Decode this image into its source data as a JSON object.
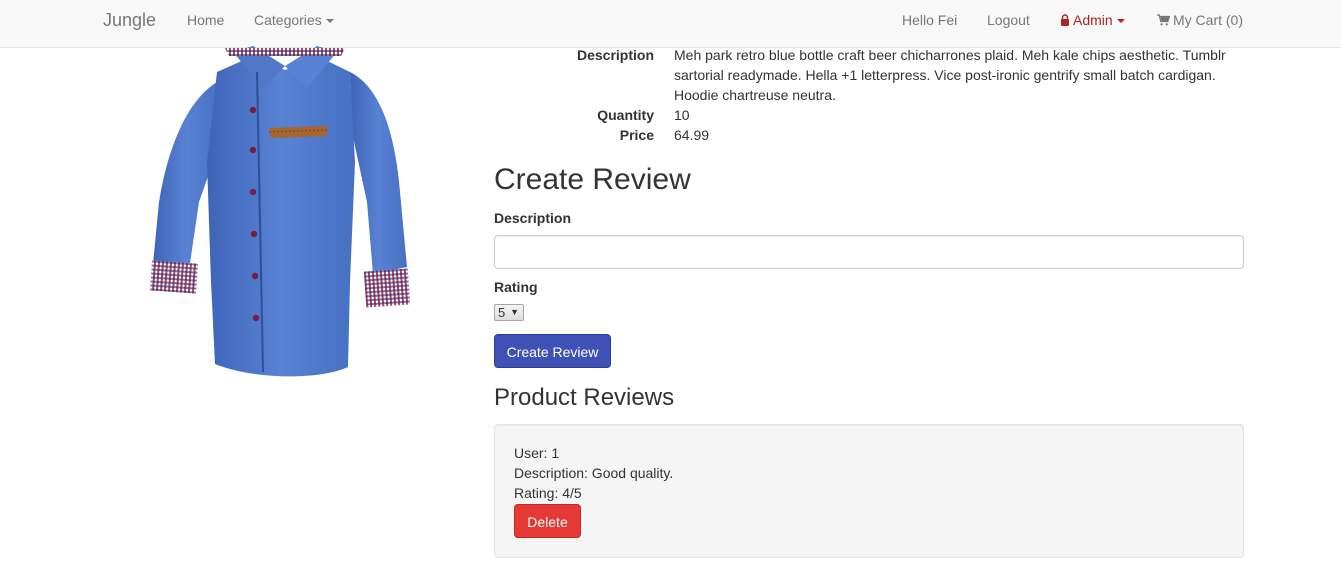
{
  "navbar": {
    "brand": "Jungle",
    "home": "Home",
    "categories": "Categories",
    "greeting": "Hello Fei",
    "logout": "Logout",
    "admin": "Admin",
    "cart": "My Cart (0)"
  },
  "product": {
    "description_label": "Description",
    "description_lines": [
      "Meh park retro blue bottle craft beer chicharrones plaid. Meh kale chips aesthetic. Tumblr",
      "sartorial readymade. Hella +1 letterpress. Vice post-ironic gentrify small batch cardigan.",
      "Hoodie chartreuse neutra."
    ],
    "quantity_label": "Quantity",
    "quantity": "10",
    "price_label": "Price",
    "price": "64.99"
  },
  "create_review": {
    "title": "Create Review",
    "description_label": "Description",
    "description_value": "",
    "rating_label": "Rating",
    "rating_selected": "5",
    "submit_label": "Create Review"
  },
  "reviews": {
    "title": "Product Reviews",
    "items": [
      {
        "user": "User: 1",
        "description": "Description: Good quality.",
        "rating": "Rating: 4/5",
        "delete_label": "Delete"
      }
    ]
  },
  "colors": {
    "primary_button": "#3f51b5",
    "danger_button": "#e53935",
    "admin_link": "#b22222",
    "shirt": "#4f77c9"
  }
}
